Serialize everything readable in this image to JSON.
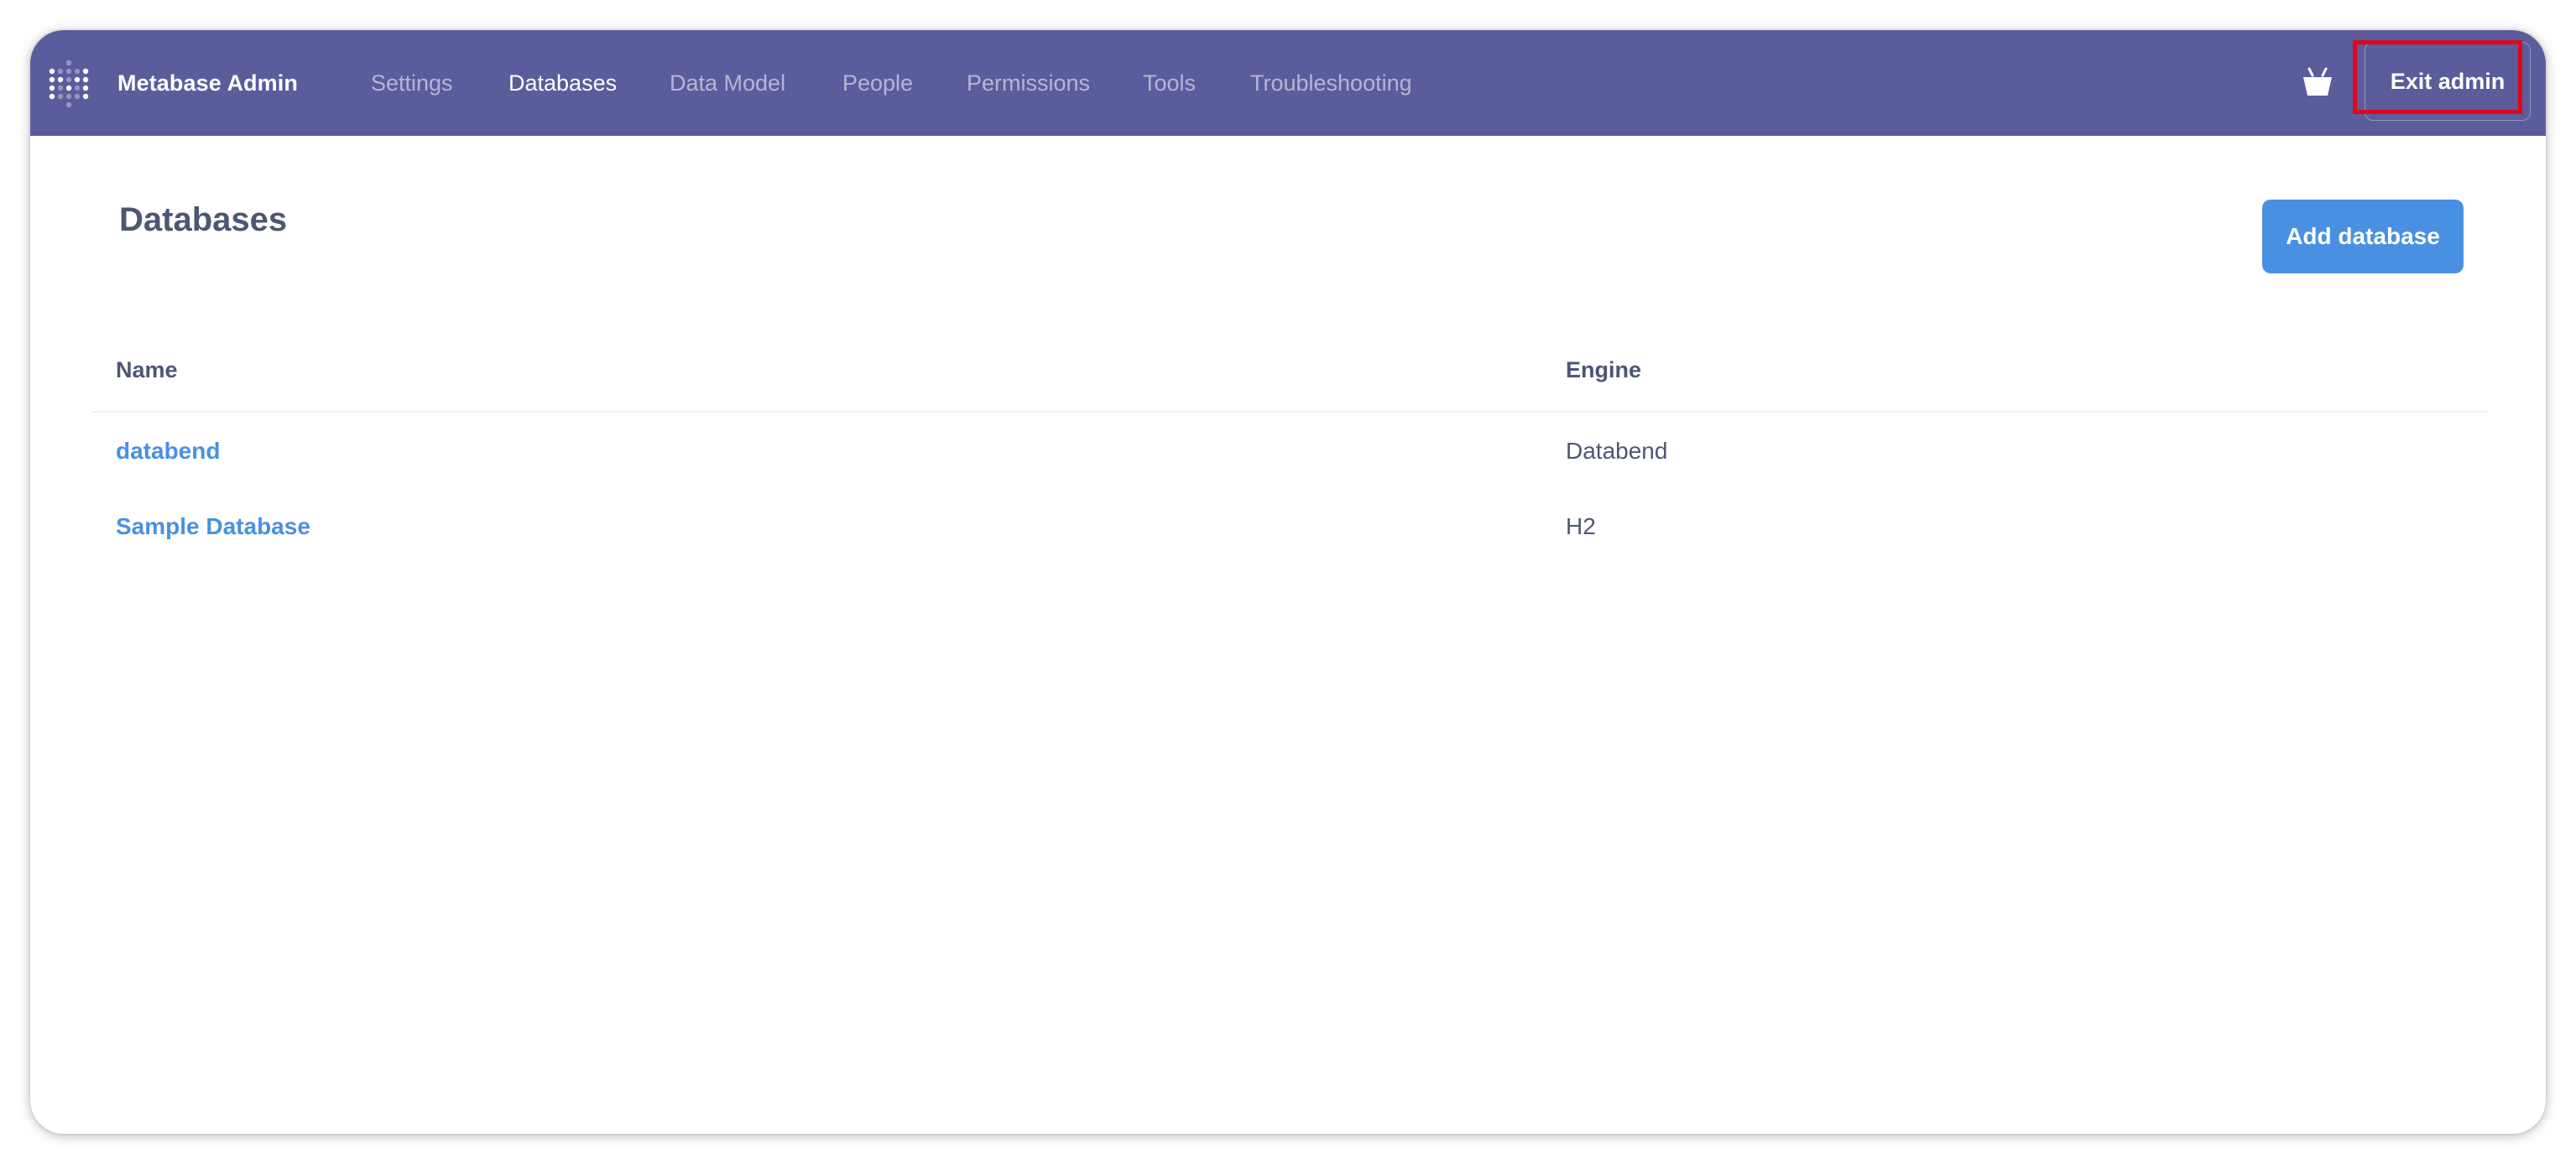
{
  "navbar": {
    "brand": "Metabase Admin",
    "links": [
      {
        "label": "Settings",
        "active": false
      },
      {
        "label": "Databases",
        "active": true
      },
      {
        "label": "Data Model",
        "active": false
      },
      {
        "label": "People",
        "active": false
      },
      {
        "label": "Permissions",
        "active": false
      },
      {
        "label": "Tools",
        "active": false
      },
      {
        "label": "Troubleshooting",
        "active": false
      }
    ],
    "store_icon": "store-basket-icon",
    "exit_label": "Exit admin",
    "colors": {
      "background": "#5b5c9c",
      "highlight": "#e0061a"
    }
  },
  "main": {
    "title": "Databases",
    "add_button_label": "Add database",
    "accent": "#4a90e2",
    "table": {
      "headers": [
        "Name",
        "Engine"
      ],
      "rows": [
        {
          "name": "databend",
          "engine": "Databend"
        },
        {
          "name": "Sample Database",
          "engine": "H2"
        }
      ]
    }
  }
}
